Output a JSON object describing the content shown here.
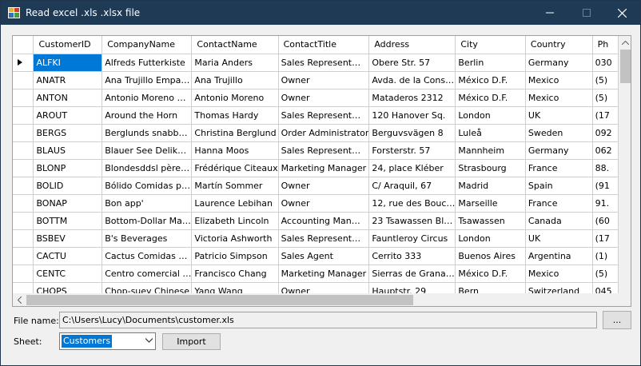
{
  "window": {
    "title": "Read excel .xls .xlsx file",
    "minimize_label": "Minimize",
    "maximize_label": "Maximize",
    "close_label": "Close"
  },
  "grid": {
    "columns": [
      "CustomerID",
      "CompanyName",
      "ContactName",
      "ContactTitle",
      "Address",
      "City",
      "Country",
      "Ph"
    ],
    "rows": [
      [
        "ALFKI",
        "Alfreds Futterkiste",
        "Maria Anders",
        "Sales Represent…",
        "Obere Str. 57",
        "Berlin",
        "Germany",
        "030"
      ],
      [
        "ANATR",
        "Ana Trujillo Empa…",
        "Ana Trujillo",
        "Owner",
        "Avda. de la Cons…",
        "México D.F.",
        "Mexico",
        "(5)"
      ],
      [
        "ANTON",
        "Antonio Moreno …",
        "Antonio Moreno",
        "Owner",
        "Mataderos  2312",
        "México D.F.",
        "Mexico",
        "(5)"
      ],
      [
        "AROUT",
        "Around the Horn",
        "Thomas Hardy",
        "Sales Represent…",
        "120 Hanover Sq.",
        "London",
        "UK",
        "(17"
      ],
      [
        "BERGS",
        "Berglunds snabb…",
        "Christina Berglund",
        "Order Administrator",
        "Berguvsvägen  8",
        "Luleå",
        "Sweden",
        "092"
      ],
      [
        "BLAUS",
        "Blauer See Delik…",
        "Hanna Moos",
        "Sales Represent…",
        "Forsterstr. 57",
        "Mannheim",
        "Germany",
        "062"
      ],
      [
        "BLONP",
        "Blondesddsl père…",
        "Frédérique Citeaux",
        "Marketing Manager",
        "24, place Kléber",
        "Strasbourg",
        "France",
        "88."
      ],
      [
        "BOLID",
        "Bólido Comidas p…",
        "Martín Sommer",
        "Owner",
        "C/ Araquil, 67",
        "Madrid",
        "Spain",
        "(91"
      ],
      [
        "BONAP",
        "Bon app'",
        "Laurence Lebihan",
        "Owner",
        "12, rue des Bouc…",
        "Marseille",
        "France",
        "91."
      ],
      [
        "BOTTM",
        "Bottom-Dollar Ma…",
        "Elizabeth Lincoln",
        "Accounting Man…",
        "23 Tsawassen Bl…",
        "Tsawassen",
        "Canada",
        "(60"
      ],
      [
        "BSBEV",
        "B's Beverages",
        "Victoria Ashworth",
        "Sales Represent…",
        "Fauntleroy Circus",
        "London",
        "UK",
        "(17"
      ],
      [
        "CACTU",
        "Cactus Comidas …",
        "Patricio Simpson",
        "Sales Agent",
        "Cerrito 333",
        "Buenos Aires",
        "Argentina",
        "(1)"
      ],
      [
        "CENTC",
        "Centro comercial …",
        "Francisco Chang",
        "Marketing Manager",
        "Sierras de Grana…",
        "México D.F.",
        "Mexico",
        "(5)"
      ],
      [
        "CHOPS",
        "Chop-suey Chinese",
        "Yang Wang",
        "Owner",
        "Hauptstr. 29",
        "Bern",
        "Switzerland",
        "045"
      ]
    ]
  },
  "form": {
    "file_label": "File name:",
    "file_value": "C:\\Users\\Lucy\\Documents\\customer.xls",
    "browse_label": "...",
    "sheet_label": "Sheet:",
    "sheet_value": "Customers",
    "import_label": "Import"
  },
  "colors": {
    "titlebar": "#1f3a55",
    "selection": "#0078d7"
  }
}
